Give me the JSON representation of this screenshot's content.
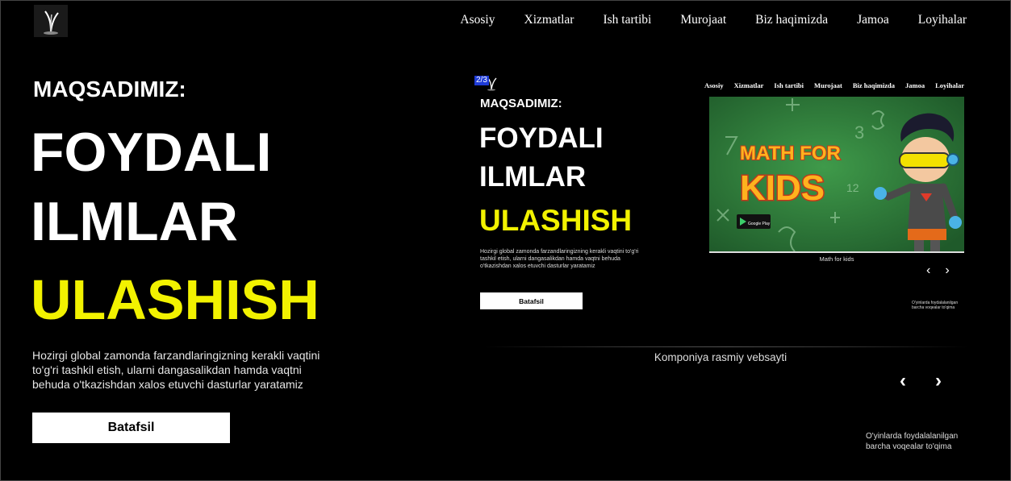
{
  "nav": {
    "items": [
      "Asosiy",
      "Xizmatlar",
      "Ish tartibi",
      "Murojaat",
      "Biz haqimizda",
      "Jamoa",
      "Loyihalar"
    ]
  },
  "hero": {
    "kicker": "MAQSADIMIZ:",
    "line1": "FOYDALI",
    "line2": "ILMLAR",
    "line3": "ULASHISH",
    "description": "Hozirgi global zamonda farzandlaringizning kerakli vaqtini to'g'ri tashkil etish, ularni dangasalikdan hamda vaqtni behuda o'tkazishdan xalos etuvchi dasturlar yaratamiz",
    "button_label": "Batafsil"
  },
  "preview": {
    "counter": "2/3",
    "nav": [
      "Asosiy",
      "Xizmatlar",
      "Ish tartibi",
      "Murojaat",
      "Biz haqimizda",
      "Jamoa",
      "Loyihalar"
    ],
    "kicker": "MAQSADIMIZ:",
    "line1": "FOYDALI",
    "line2": "ILMLAR",
    "line3": "ULASHISH",
    "description": "Hozirgi global zamonda farzandlaringizning kerakli vaqtini to'g'ri tashkil etish, ularni dangasalikdan hamda vaqtni behuda o'tkazishdan xalos etuvchi dasturlar yaratamiz",
    "button_label": "Batafsil",
    "slide": {
      "title_line1": "MATH FOR",
      "title_line2": "KIDS",
      "store_badge": "Google Play",
      "caption": "Math for kids"
    },
    "prev_arrow": "‹",
    "next_arrow": "›",
    "side_note": "O'yinlarda foydalalanilgan barcha voqealar to'qima"
  },
  "company_caption": "Komponiya rasmiy vebsayti",
  "carousel": {
    "prev_arrow": "‹",
    "next_arrow": "›"
  },
  "side_note": "O'yinlarda foydalalanilgan barcha voqealar to'qima",
  "colors": {
    "background": "#000000",
    "accent_yellow": "#f2f200",
    "counter_blue": "#1e3bd6",
    "chalkboard_green": "#2f7a3a"
  },
  "icons": {
    "logo": "plant-sprout-logo",
    "prev": "chevron-left-icon",
    "next": "chevron-right-icon"
  }
}
